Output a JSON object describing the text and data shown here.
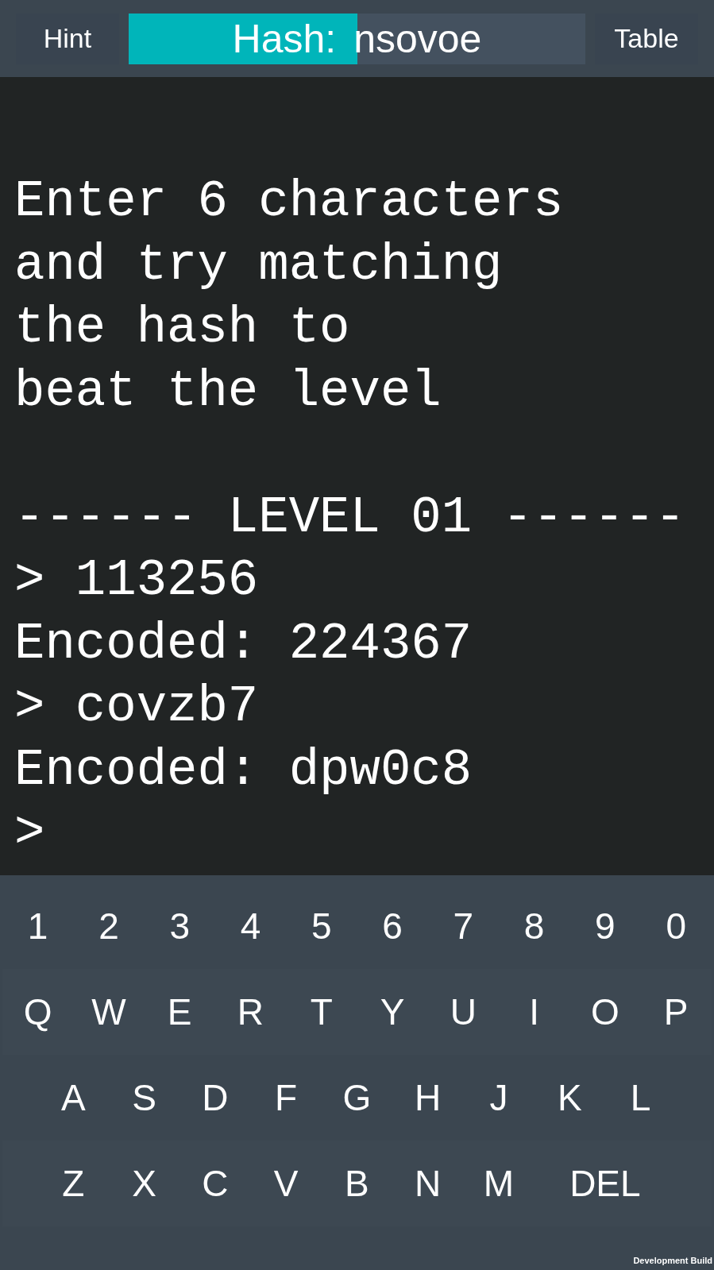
{
  "top_bar": {
    "hint_button": "Hint",
    "hash": {
      "label": "Hash:",
      "value": "nsovoe",
      "level": 0.5
    },
    "table_button": "Table"
  },
  "terminal": {
    "intro": [
      "Enter 6 characters",
      "and try matching",
      "the hash to",
      "beat the level"
    ],
    "lines": [
      "------ LEVEL 01 ------",
      "> 113256",
      "Encoded: 224367",
      "> covzb7",
      "Encoded: dpw0c8",
      ">"
    ]
  },
  "keyboard": {
    "rows": [
      {
        "keys": [
          "1",
          "2",
          "3",
          "4",
          "5",
          "6",
          "7",
          "8",
          "9",
          "0"
        ]
      },
      {
        "keys": [
          "Q",
          "W",
          "E",
          "R",
          "T",
          "Y",
          "U",
          "I",
          "O",
          "P"
        ]
      },
      {
        "keys": [
          "A",
          "S",
          "D",
          "F",
          "G",
          "H",
          "J",
          "K",
          "L"
        ]
      },
      {
        "keys": [
          "Z",
          "X",
          "C",
          "V",
          "B",
          "N",
          "M",
          "DEL"
        ]
      }
    ]
  },
  "build_label": "Development Build"
}
